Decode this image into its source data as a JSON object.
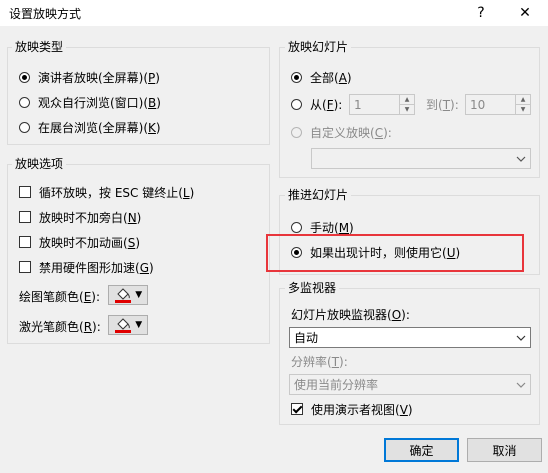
{
  "window": {
    "title": "设置放映方式",
    "help": "?",
    "close": "✕"
  },
  "show_type": {
    "title": "放映类型",
    "options": [
      {
        "label": "演讲者放映(全屏幕)(",
        "key": "P",
        "end": ")"
      },
      {
        "label": "观众自行浏览(窗口)(",
        "key": "B",
        "end": ")"
      },
      {
        "label": "在展台浏览(全屏幕)(",
        "key": "K",
        "end": ")"
      }
    ],
    "selected": 0
  },
  "show_options": {
    "title": "放映选项",
    "checks": [
      {
        "label": "循环放映，按 ESC 键终止(",
        "key": "L",
        "end": ")"
      },
      {
        "label": "放映时不加旁白(",
        "key": "N",
        "end": ")"
      },
      {
        "label": "放映时不加动画(",
        "key": "S",
        "end": ")"
      },
      {
        "label": "禁用硬件图形加速(",
        "key": "G",
        "end": ")"
      }
    ],
    "pen_label": "绘图笔颜色(",
    "pen_key": "E",
    "pen_end": "):",
    "laser_label": "激光笔颜色(",
    "laser_key": "R",
    "laser_end": "):",
    "pen_color": "#e00000",
    "laser_color": "#e00000"
  },
  "slides": {
    "title": "放映幻灯片",
    "all_label": "全部(",
    "all_key": "A",
    "all_end": ")",
    "from_label": "从(",
    "from_key": "F",
    "from_end": "):",
    "from_value": "1",
    "to_label": "到(",
    "to_key": "T",
    "to_end": "):",
    "to_value": "10",
    "custom_label": "自定义放映(",
    "custom_key": "C",
    "custom_end": "):"
  },
  "advance": {
    "title": "推进幻灯片",
    "manual_label": "手动(",
    "manual_key": "M",
    "manual_end": ")",
    "timing_label": "如果出现计时，则使用它(",
    "timing_key": "U",
    "timing_end": ")",
    "highlight_color": "#e8353b"
  },
  "monitors": {
    "title": "多监视器",
    "monitor_label": "幻灯片放映监视器(",
    "monitor_key": "O",
    "monitor_end": "):",
    "monitor_value": "自动",
    "resolution_label": "分辨率(",
    "resolution_key": "T",
    "resolution_end": "):",
    "resolution_value": "使用当前分辨率",
    "presenter_label": "使用演示者视图(",
    "presenter_key": "V",
    "presenter_end": ")"
  },
  "buttons": {
    "ok": "确定",
    "cancel": "取消"
  }
}
